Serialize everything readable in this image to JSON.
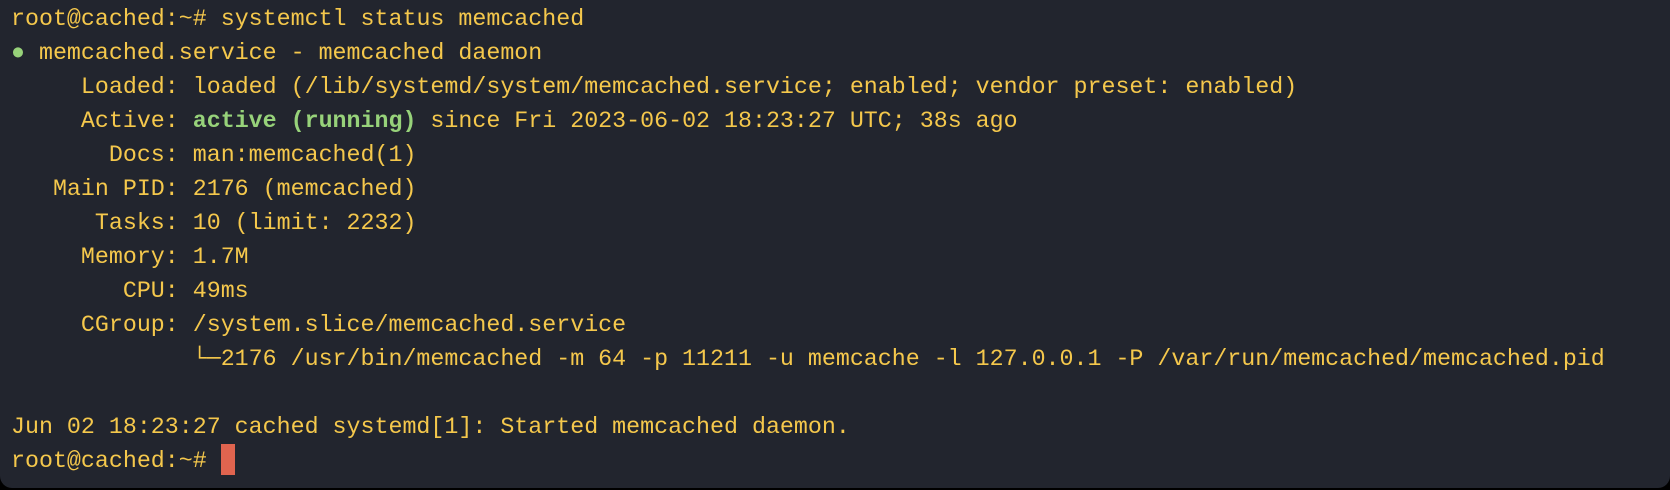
{
  "terminal": {
    "prompt": "root@cached:~# ",
    "command": "systemctl status memcached",
    "status_dot": "●",
    "service_line": " memcached.service - memcached daemon",
    "loaded_label": "     Loaded: ",
    "loaded_value": "loaded (/lib/systemd/system/memcached.service; enabled; vendor preset: enabled)",
    "active_label": "     Active: ",
    "active_state": "active (running)",
    "active_since": " since Fri 2023-06-02 18:23:27 UTC; 38s ago",
    "docs": "       Docs: man:memcached(1)",
    "main_pid": "   Main PID: 2176 (memcached)",
    "tasks": "      Tasks: 10 (limit: 2232)",
    "memory": "     Memory: 1.7M",
    "cpu": "        CPU: 49ms",
    "cgroup": "     CGroup: /system.slice/memcached.service",
    "cgroup_process": "             └─2176 /usr/bin/memcached -m 64 -p 11211 -u memcache -l 127.0.0.1 -P /var/run/memcached/memcached.pid",
    "log_line": "Jun 02 18:23:27 cached systemd[1]: Started memcached daemon.",
    "final_prompt": "root@cached:~# ",
    "colors": {
      "text": "#f5c84c",
      "active": "#97d27a",
      "cursor": "#e0644f",
      "background": "#22252e"
    }
  }
}
